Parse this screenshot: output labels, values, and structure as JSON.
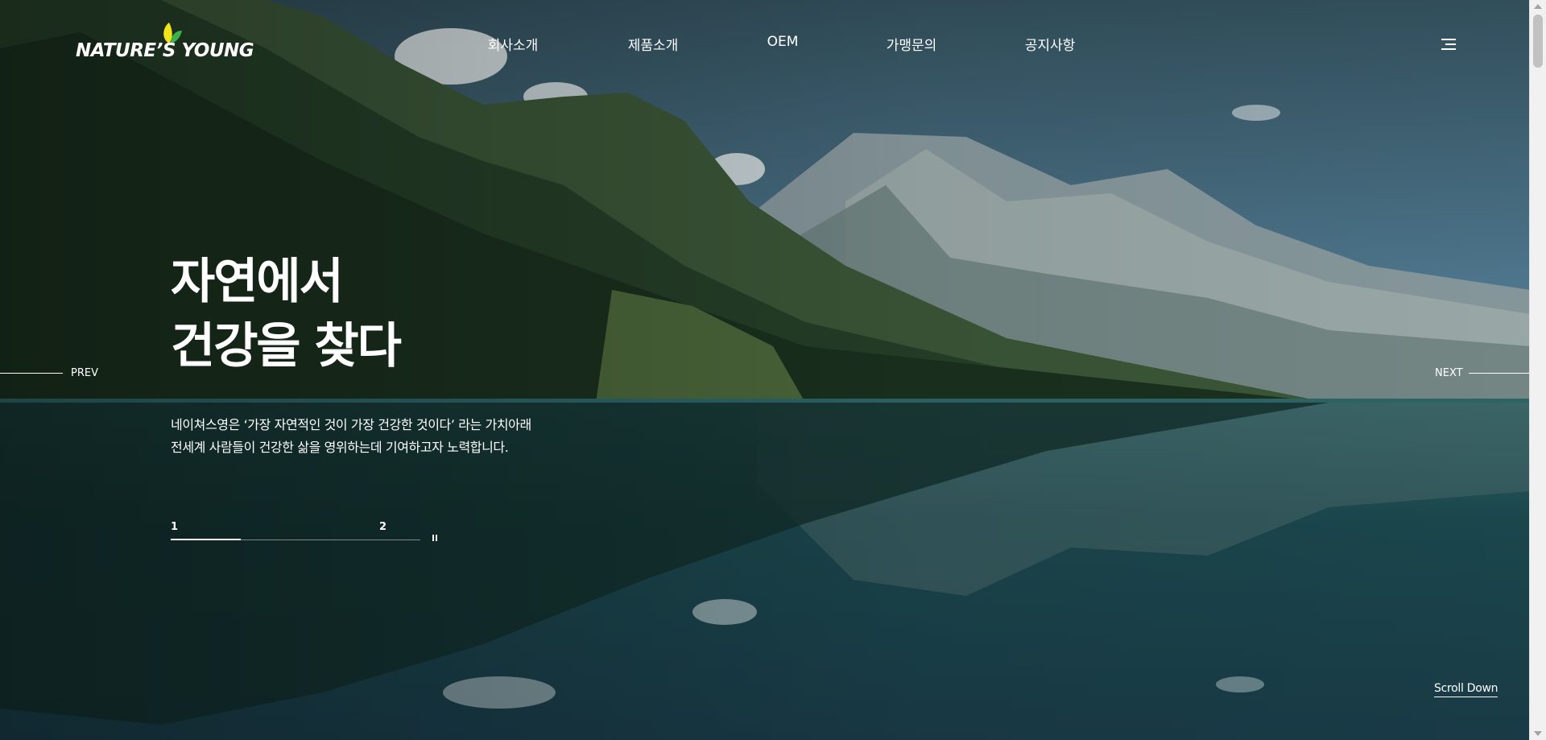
{
  "brand": {
    "logo_text": "NATURE’S YOUNG",
    "leaf_colors": [
      "#f2e31a",
      "#3bb34a"
    ]
  },
  "nav": {
    "items": [
      {
        "label": "회사소개"
      },
      {
        "label": "제품소개"
      },
      {
        "label": "OEM"
      },
      {
        "label": "가맹문의"
      },
      {
        "label": "공지사항"
      }
    ],
    "menu_icon": "hamburger-icon"
  },
  "hero": {
    "headline_line1": "자연에서",
    "headline_line2": "건강을 찾다",
    "desc_line1": "네이쳐스영은 ‘가장 자연적인 것이 가장 건강한 것이다’ 라는 가치아래",
    "desc_line2": "전세계 사람들이 건강한 삶을 영위하는데 기여하고자 노력합니다.",
    "background": "mountain-lake-photo"
  },
  "slider": {
    "pages": [
      "1",
      "2"
    ],
    "progress": 0.28,
    "pause_icon": "pause-icon",
    "prev_label": "PREV",
    "next_label": "NEXT"
  },
  "scroll_down_label": "Scroll Down",
  "colors": {
    "text": "#ffffff",
    "sky": "#6f99b8",
    "water": "#1f4d57",
    "forest": "#1f3a26"
  }
}
